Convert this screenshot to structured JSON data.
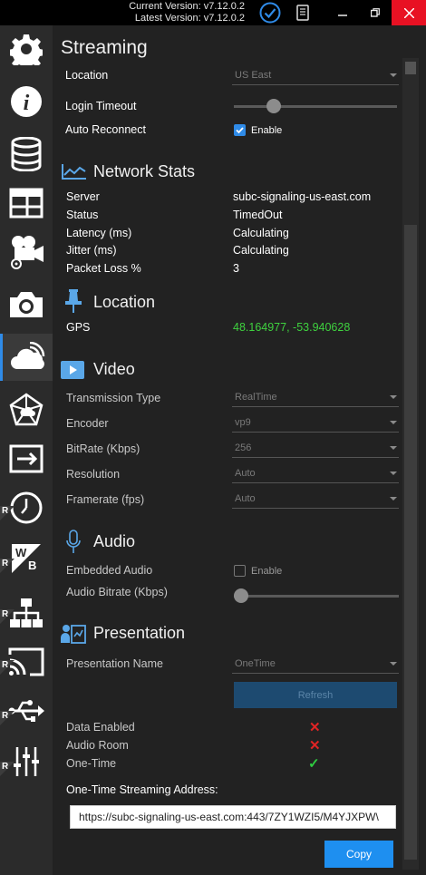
{
  "titlebar": {
    "current_version": "Current Version: v7.12.0.2",
    "latest_version": "Latest Version: v7.12.0.2"
  },
  "sidebar": {
    "r_badge": "R",
    "items": [
      {
        "icon": "gear-icon"
      },
      {
        "icon": "info-icon"
      },
      {
        "icon": "database-icon"
      },
      {
        "icon": "layout-icon"
      },
      {
        "icon": "camera-settings-icon"
      },
      {
        "icon": "camera-icon"
      },
      {
        "icon": "cloud-stream-icon",
        "active": true
      },
      {
        "icon": "network-cloud-icon"
      },
      {
        "icon": "output-icon"
      },
      {
        "icon": "clock-icon"
      },
      {
        "icon": "whiteboard-icon"
      },
      {
        "icon": "network-tree-icon"
      },
      {
        "icon": "cast-icon"
      },
      {
        "icon": "usb-icon"
      },
      {
        "icon": "sliders-icon"
      }
    ]
  },
  "streaming": {
    "title": "Streaming",
    "location_label": "Location",
    "location_value": "US East",
    "login_timeout_label": "Login Timeout",
    "login_timeout_level": 0.22,
    "auto_reconnect_label": "Auto Reconnect",
    "auto_reconnect_checkbox": "Enable"
  },
  "network_stats": {
    "title": "Network Stats",
    "rows": [
      {
        "label": "Server",
        "value": "subc-signaling-us-east.com"
      },
      {
        "label": "Status",
        "value": "TimedOut"
      },
      {
        "label": "Latency (ms)",
        "value": "Calculating"
      },
      {
        "label": "Jitter (ms)",
        "value": "Calculating"
      },
      {
        "label": "Packet Loss %",
        "value": "3"
      }
    ]
  },
  "location": {
    "title": "Location",
    "gps_label": "GPS",
    "gps_value": "48.164977, -53.940628"
  },
  "video": {
    "title": "Video",
    "rows": [
      {
        "label": "Transmission Type",
        "value": "RealTime"
      },
      {
        "label": "Encoder",
        "value": "vp9"
      },
      {
        "label": "BitRate (Kbps)",
        "value": "256"
      },
      {
        "label": "Resolution",
        "value": "Auto"
      },
      {
        "label": "Framerate (fps)",
        "value": "Auto"
      }
    ]
  },
  "audio": {
    "title": "Audio",
    "embedded_label": "Embedded Audio",
    "embedded_checkbox": "Enable",
    "bitrate_label": "Audio Bitrate (Kbps)",
    "bitrate_level": 0.0
  },
  "presentation": {
    "title": "Presentation",
    "name_label": "Presentation Name",
    "name_value": "OneTime",
    "refresh_label": "Refresh",
    "status_rows": [
      {
        "label": "Data Enabled",
        "ok": false
      },
      {
        "label": "Audio Room",
        "ok": false
      },
      {
        "label": "One-Time",
        "ok": true
      }
    ],
    "address_label": "One-Time Streaming Address:",
    "address_value": "https://subc-signaling-us-east.com:443/7ZY1WZI5/M4YJXPW\\",
    "copy_label": "Copy"
  },
  "colors": {
    "accent": "#2f8be8",
    "close": "#e81123",
    "gps": "#3fd23f",
    "error": "#e02424",
    "ok": "#2ecc40"
  }
}
